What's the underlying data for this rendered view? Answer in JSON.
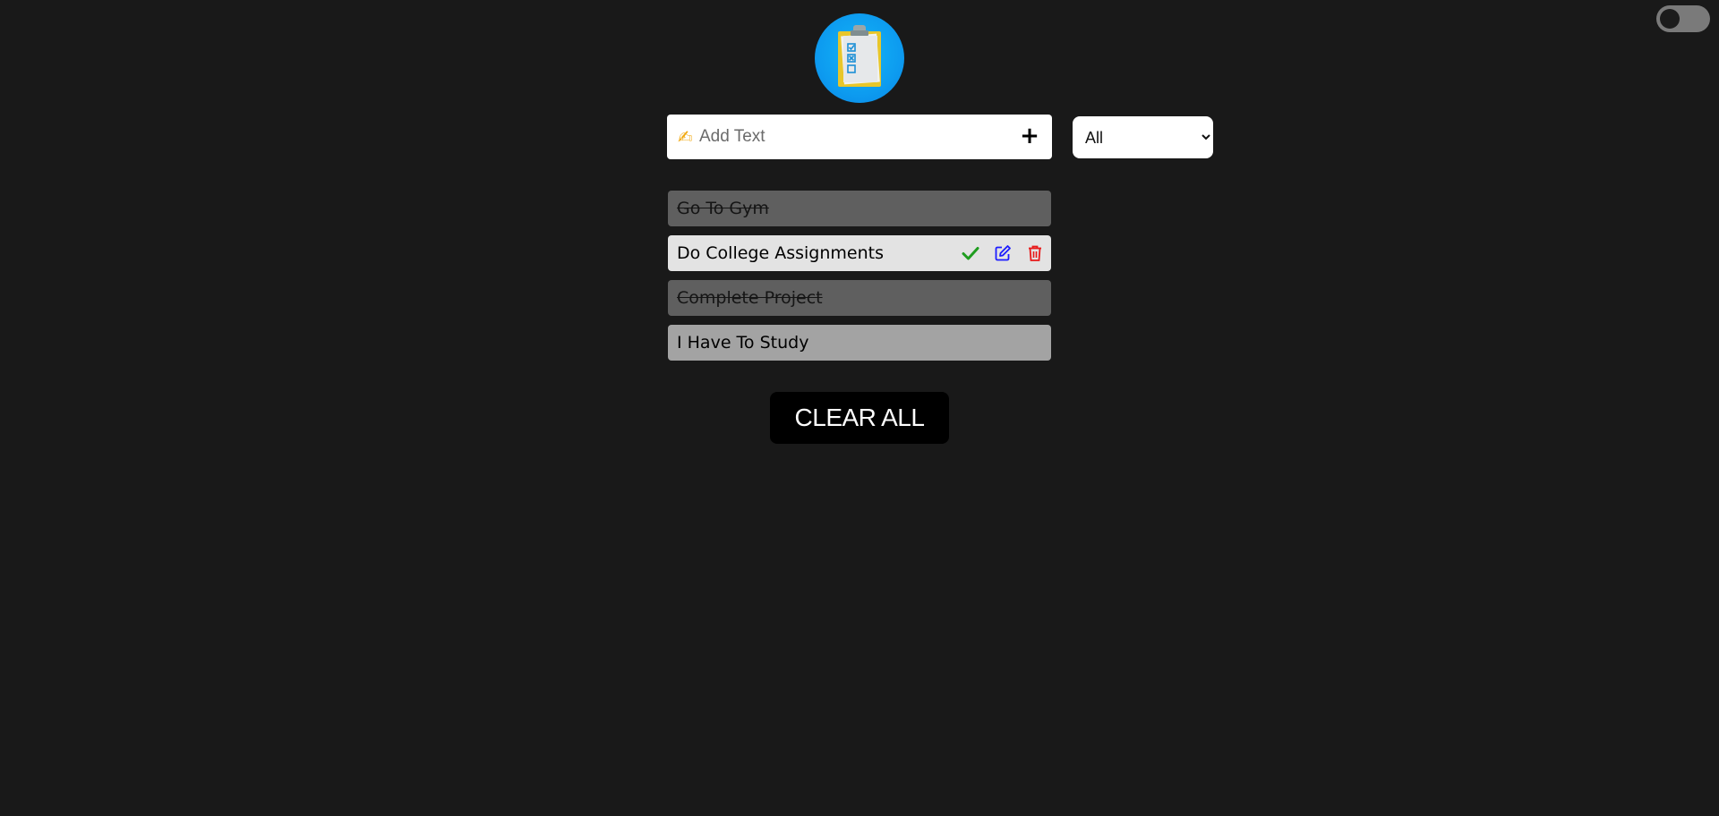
{
  "input": {
    "placeholder": "Add Text",
    "emoji": "✍",
    "add_label": "+"
  },
  "filter": {
    "selected": "All",
    "options": [
      "All"
    ]
  },
  "todos": [
    {
      "text": "Go To Gym",
      "state": "completed"
    },
    {
      "text": "Do College Assignments",
      "state": "hovered",
      "actions": [
        "check-icon",
        "edit-icon",
        "trash-icon"
      ]
    },
    {
      "text": "Complete Project",
      "state": "completed"
    },
    {
      "text": "I Have To Study",
      "state": "normal"
    }
  ],
  "clear_all_label": "CLEAR ALL",
  "colors": {
    "background": "#191919",
    "check": "#1f9d1f",
    "edit": "#1c1cff",
    "delete": "#e81919"
  }
}
